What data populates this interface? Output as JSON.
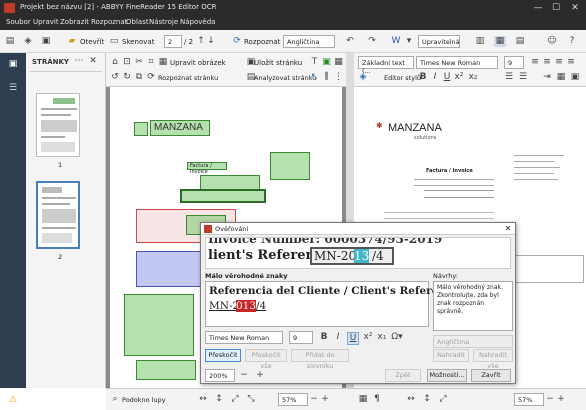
{
  "window": {
    "title": "Projekt bez názvu [2] - ABBYY FineReader 15 Editor OCR",
    "minimize": "—",
    "maximize": "☐",
    "close": "✕"
  },
  "menu": [
    "Soubor",
    "Upravit",
    "Zobrazit",
    "Rozpoznat",
    "Oblast",
    "Nástroje",
    "Nápověda"
  ],
  "toolbar": {
    "open_label": "Otevřít",
    "scan_label": "Skenovat",
    "page_current": "2",
    "page_total": "/ 2",
    "recognize_label": "Rozpoznat",
    "language": "Angličtina",
    "format": "Upravitelná"
  },
  "pages_panel": {
    "title": "STRÁNKY",
    "thumb1_label": "1",
    "thumb2_label": "2"
  },
  "image_toolbar": {
    "edit_image": "Upravit obrázek",
    "recognize_page": "Rozpoznat stránku",
    "save_page": "Uložit stránku",
    "analyze_page": "Analyzovat stránku"
  },
  "text_toolbar": {
    "style": "Základní text (...",
    "font": "Times New Roman",
    "size": "9",
    "style_editor": "Editor stylů"
  },
  "document": {
    "company": "MANZANA",
    "company_sub": "solutions",
    "invoice_title": "Factura / Invoice",
    "client_ref_label": "Referencia del Cliente / Client's Reference:",
    "client_ref_value": "MN-2013/4"
  },
  "dialog": {
    "title": "Ověřování",
    "zoom_text_top": "Invoice Number: 0000374/93-2019",
    "zoom_text_bottom_label": "lient's Reference:",
    "zoom_text_bottom_value_a": "MN-20",
    "zoom_text_bottom_value_hl": "13",
    "zoom_text_bottom_value_b": "/4",
    "uncertain_label": "Málo věrohodné znaky",
    "edit_line_1": "Referencia del Cliente / Client's Reference:",
    "edit_value_a": "MN-2",
    "edit_value_hl": "013",
    "edit_value_b": "/4",
    "suggestions_label": "Návrhy:",
    "suggestion_text": "Málo věrohodný znak. Zkontrolujte, zda byl znak rozpoznán správně.",
    "dict_field": "Angličtina",
    "font": "Times New Roman",
    "size": "9",
    "skip_label": "Přeskočit",
    "skip_all_label": "Přeskočit vše",
    "add_dict_label": "Přidat do slovníku",
    "replace_label": "Nahradit",
    "replace_all_label": "Nahradit vše",
    "zoom": "200%",
    "undo_label": "Zpět",
    "options_label": "Možnosti...",
    "close_label": "Zavřít"
  },
  "statusbar": {
    "magnifier": "Podokno lupy",
    "zoom_left": "57%",
    "zoom_right": "57%"
  }
}
